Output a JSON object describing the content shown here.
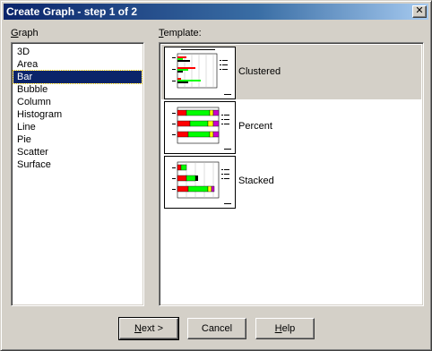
{
  "window": {
    "title": "Create Graph - step 1 of 2",
    "close_glyph": "✕"
  },
  "graph": {
    "label_accel": "G",
    "label_rest": "raph",
    "items": [
      "3D",
      "Area",
      "Bar",
      "Bubble",
      "Column",
      "Histogram",
      "Line",
      "Pie",
      "Scatter",
      "Surface"
    ],
    "selected": "Bar"
  },
  "template": {
    "label_accel": "T",
    "label_rest": "emplate:",
    "items": [
      {
        "label": "Clustered",
        "icon": "clustered-bar-chart-icon"
      },
      {
        "label": "Percent",
        "icon": "percent-bar-chart-icon"
      },
      {
        "label": "Stacked",
        "icon": "stacked-bar-chart-icon"
      }
    ],
    "selected": "Clustered"
  },
  "buttons": {
    "next_accel": "N",
    "next_rest": "ext >",
    "cancel": "Cancel",
    "help_accel": "H",
    "help_rest": "elp"
  },
  "colors": {
    "titlebar_start": "#0a246a",
    "selection": "#0a246a",
    "bar_red": "#ff0000",
    "bar_green": "#00ff00",
    "bar_yellow": "#ffff00",
    "bar_purple": "#cc00cc"
  }
}
